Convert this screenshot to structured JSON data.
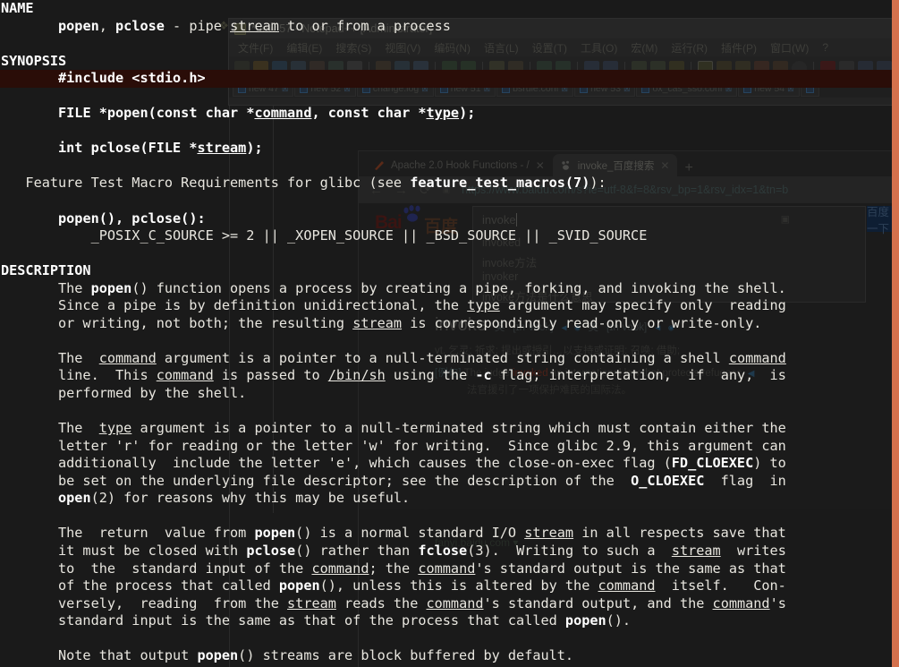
{
  "terminal": {
    "kind": "man-page",
    "page": "popen(3)",
    "font_color": "#e8e6df",
    "background": "#1a1a1a",
    "highlight_color": "#2a0d08",
    "edge_strip_color": "#d4714d",
    "sections": [
      {
        "heading": "NAME"
      },
      {
        "heading": "SYNOPSIS"
      },
      {
        "heading": "DESCRIPTION"
      }
    ],
    "lines": [
      {
        "id": "l00",
        "indent": 0,
        "text": "NAME",
        "style": "heading"
      },
      {
        "id": "l01",
        "indent": 7,
        "text": "popen, pclose - pipe stream to or from a process"
      },
      {
        "id": "l02",
        "indent": 0,
        "text": ""
      },
      {
        "id": "l03",
        "indent": 0,
        "text": "SYNOPSIS",
        "style": "heading"
      },
      {
        "id": "l04",
        "indent": 7,
        "text": "#include <stdio.h>",
        "style": "bold-highlight"
      },
      {
        "id": "l05",
        "indent": 0,
        "text": ""
      },
      {
        "id": "l06",
        "indent": 7,
        "text": "FILE *popen(const char *command, const char *type);",
        "style": "synopsis"
      },
      {
        "id": "l07",
        "indent": 0,
        "text": ""
      },
      {
        "id": "l08",
        "indent": 7,
        "text": "int pclose(FILE *stream);",
        "style": "synopsis"
      },
      {
        "id": "l09",
        "indent": 0,
        "text": ""
      },
      {
        "id": "l10",
        "indent": 3,
        "text": "Feature Test Macro Requirements for glibc (see feature_test_macros(7)):"
      },
      {
        "id": "l11",
        "indent": 0,
        "text": ""
      },
      {
        "id": "l12",
        "indent": 7,
        "text": "popen(), pclose():",
        "style": "bold"
      },
      {
        "id": "l13",
        "indent": 11,
        "text": "_POSIX_C_SOURCE >= 2 || _XOPEN_SOURCE || _BSD_SOURCE || _SVID_SOURCE"
      },
      {
        "id": "l14",
        "indent": 0,
        "text": ""
      },
      {
        "id": "l15",
        "indent": 0,
        "text": "DESCRIPTION",
        "style": "heading"
      },
      {
        "id": "l16",
        "indent": 7,
        "text": "The popen() function opens a process by creating a pipe, forking, and invoking the shell."
      },
      {
        "id": "l17",
        "indent": 7,
        "text": "Since a pipe is by definition unidirectional, the type argument may specify only  reading"
      },
      {
        "id": "l18",
        "indent": 7,
        "text": "or writing, not both; the resulting stream is correspondingly read-only or write-only."
      },
      {
        "id": "l19",
        "indent": 0,
        "text": ""
      },
      {
        "id": "l20",
        "indent": 7,
        "text": "The  command argument is a pointer to a null-terminated string containing a shell command"
      },
      {
        "id": "l21",
        "indent": 7,
        "text": "line.  This command is passed to /bin/sh using the -c flag; interpretation,  if  any,  is"
      },
      {
        "id": "l22",
        "indent": 7,
        "text": "performed by the shell."
      },
      {
        "id": "l23",
        "indent": 0,
        "text": ""
      },
      {
        "id": "l24",
        "indent": 7,
        "text": "The  type argument is a pointer to a null-terminated string which must contain either the"
      },
      {
        "id": "l25",
        "indent": 7,
        "text": "letter 'r' for reading or the letter 'w' for writing.  Since glibc 2.9, this argument can"
      },
      {
        "id": "l26",
        "indent": 7,
        "text": "additionally  include the letter 'e', which causes the close-on-exec flag (FD_CLOEXEC) to"
      },
      {
        "id": "l27",
        "indent": 7,
        "text": "be set on the underlying file descriptor; see the description of the  O_CLOEXEC  flag  in"
      },
      {
        "id": "l28",
        "indent": 7,
        "text": "open(2) for reasons why this may be useful."
      },
      {
        "id": "l29",
        "indent": 0,
        "text": ""
      },
      {
        "id": "l30",
        "indent": 7,
        "text": "The  return  value from popen() is a normal standard I/O stream in all respects save that"
      },
      {
        "id": "l31",
        "indent": 7,
        "text": "it must be closed with pclose() rather than fclose(3).  Writing to such a  stream  writes"
      },
      {
        "id": "l32",
        "indent": 7,
        "text": "to  the  standard input of the command; the command's standard output is the same as that"
      },
      {
        "id": "l33",
        "indent": 7,
        "text": "of the process that called popen(), unless this is altered by the command  itself.   Con-"
      },
      {
        "id": "l34",
        "indent": 7,
        "text": "versely,  reading  from the stream reads the command's standard output, and the command's"
      },
      {
        "id": "l35",
        "indent": 7,
        "text": "standard input is the same as that of the process that called popen()."
      },
      {
        "id": "l36",
        "indent": 0,
        "text": ""
      },
      {
        "id": "l37",
        "indent": 7,
        "text": "Note that output popen() streams are block buffered by default."
      }
    ]
  },
  "notepad": {
    "title": "*new 57 - Notepad++ [Administrator]",
    "menu": [
      "文件(F)",
      "编辑(E)",
      "搜索(S)",
      "视图(V)",
      "编码(N)",
      "语言(L)",
      "设置(T)",
      "工具(O)",
      "宏(M)",
      "运行(R)",
      "插件(P)",
      "窗口(W)",
      "?"
    ],
    "tabs": [
      "new 47",
      "new 52",
      "change.log",
      "new 51",
      "bsrule.conf",
      "new 53",
      "ox_cas_sso.conf",
      "new 54"
    ],
    "close_glyph": "⊠"
  },
  "browser": {
    "tabs": [
      {
        "title": "Apache 2.0 Hook Functions - /",
        "active": false
      },
      {
        "title": "invoke_百度搜索",
        "active": true
      }
    ],
    "new_tab_glyph": "+",
    "close_glyph": "✕",
    "nav": {
      "back": "←",
      "forward": "→",
      "reload": "⟳",
      "lock": "▣"
    },
    "url": "https://www.baidu.com/s?ie=utf-8&f=8&rsv_bp=1&rsv_idx=1&tn=b",
    "page": {
      "logo_text": "Bai",
      "logo_cn": "百度",
      "search_value": "invoke",
      "search_button": "百度一下",
      "camera_glyph": "▣",
      "suggestions": [
        "invoked",
        "invoke方法",
        "invoker",
        "invoke方法是什么意思"
      ],
      "dictionary": {
        "word": "invoke",
        "uk_label": "英",
        "uk_phonetic": "[ɪnˈvəʊk]",
        "us_label": "美",
        "us_phonetic": "[ɪnˈvoʊk]",
        "speaker_glyph": "◀",
        "play_glyph": "◉",
        "pos": "vt.",
        "defs": "乞灵; 祈求; 提出或授引…以支持或证明; 召唤; 借助;",
        "example_tag": "[例句]",
        "example_en_pre": "The judge ",
        "example_en_hl": "invoked",
        "example_en_post": " an international law that protects refugees.",
        "example_cn": "法官援引了一项保护难民的国际法。"
      },
      "source": "fanyi.baidu.com",
      "source_caret": "▾"
    }
  }
}
